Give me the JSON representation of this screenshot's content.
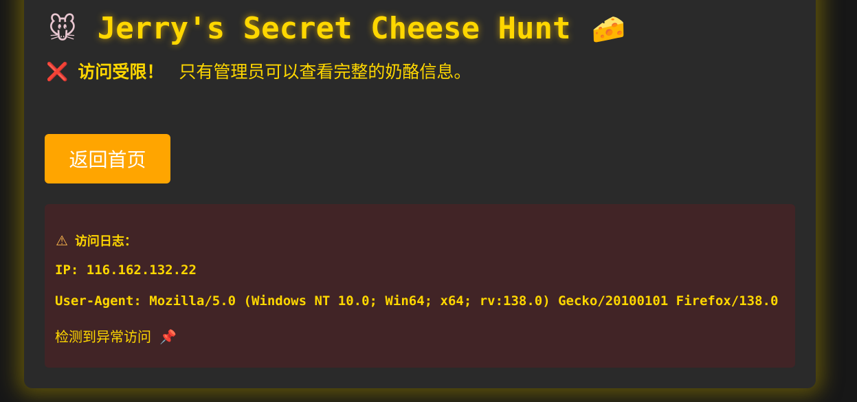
{
  "header": {
    "title": "Jerry's Secret Cheese Hunt",
    "leading_icon": "🐭",
    "trailing_icon": "🧀"
  },
  "notice": {
    "icon": "❌",
    "strong_text": "访问受限！",
    "message": "只有管理员可以查看完整的奶酪信息。"
  },
  "actions": {
    "home_button_label": "返回首页"
  },
  "log": {
    "heading_icon": "⚠",
    "heading": "访问日志：",
    "ip_line": "IP: 116.162.132.22",
    "user_agent_line": "User-Agent: Mozilla/5.0 (Windows NT 10.0; Win64; x64; rv:138.0) Gecko/20100101 Firefox/138.0",
    "alert_text": "检测到异常访问",
    "alert_icon": "📌"
  },
  "colors": {
    "accent": "#ffd700",
    "button": "#ffa500",
    "card_background": "#2a2a2a",
    "log_background": "#412426",
    "error": "#ff4d6a"
  }
}
